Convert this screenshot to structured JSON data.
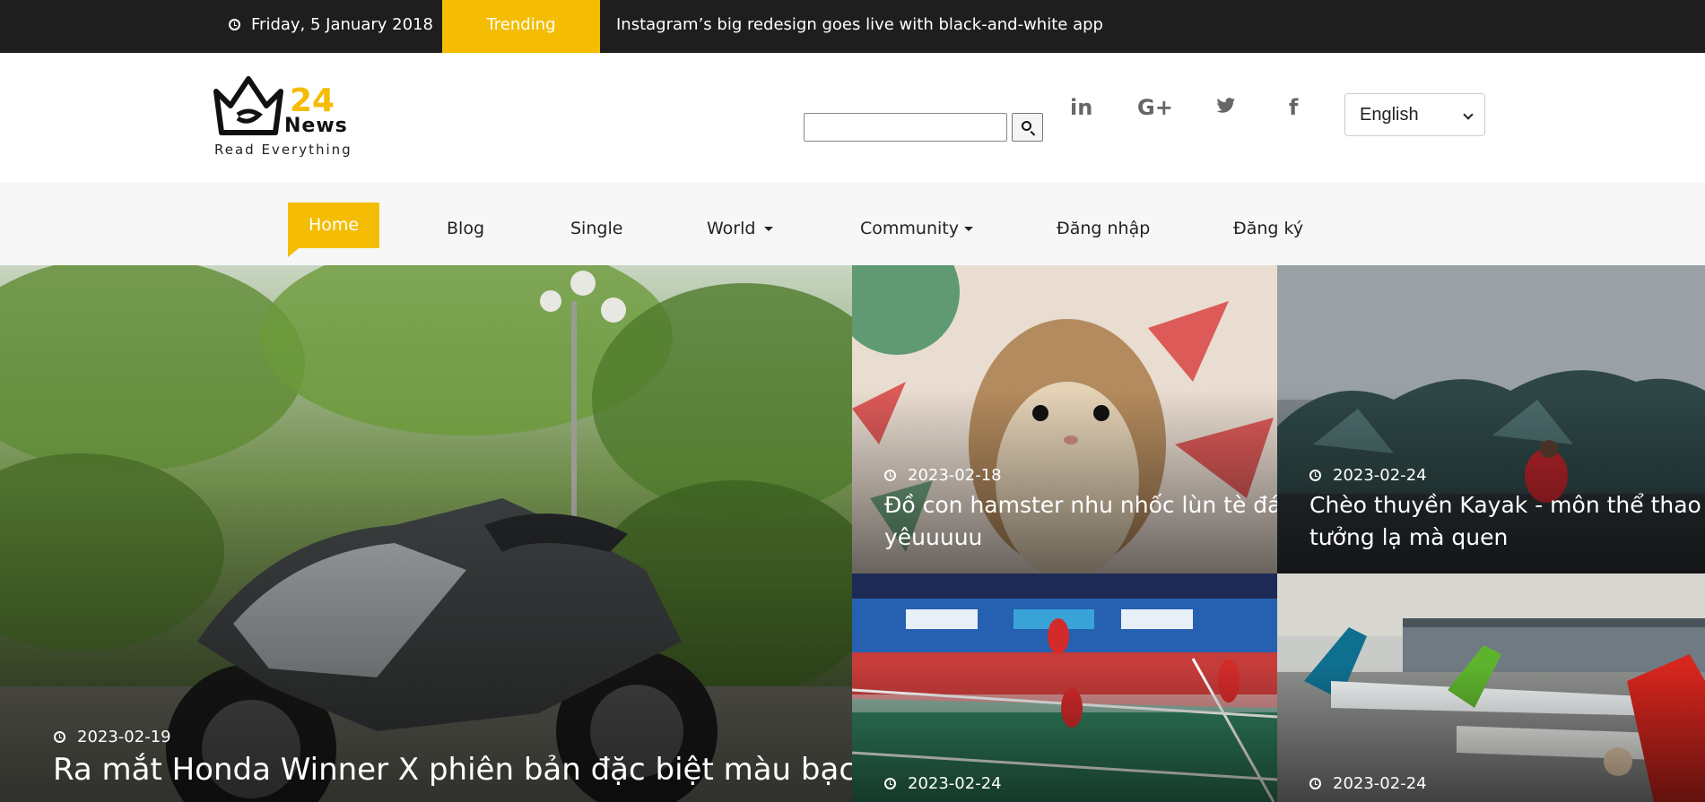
{
  "topbar": {
    "date": "Friday, 5 January 2018",
    "trending_label": "Trending",
    "headline": "Instagram’s big redesign goes live with black-and-white app"
  },
  "logo": {
    "number": "24",
    "word": "News",
    "tagline": "Read Everything"
  },
  "search": {
    "placeholder": "",
    "value": "",
    "button_icon": "search-icon"
  },
  "social": [
    {
      "name": "linkedin-icon",
      "glyph": "in"
    },
    {
      "name": "google-plus-icon",
      "glyph": "G+"
    },
    {
      "name": "twitter-icon",
      "glyph": "t"
    },
    {
      "name": "facebook-icon",
      "glyph": "f"
    }
  ],
  "language": {
    "selected": "English"
  },
  "nav": {
    "items": [
      {
        "label": "Home",
        "active": true
      },
      {
        "label": "Blog"
      },
      {
        "label": "Single"
      },
      {
        "label": "World",
        "dropdown": true
      },
      {
        "label": "Community",
        "dropdown": true
      },
      {
        "label": "Đăng nhập"
      },
      {
        "label": "Đăng ký"
      }
    ]
  },
  "featured": {
    "main": {
      "date": "2023-02-19",
      "title": "Ra mắt Honda Winner X phiên bản đặc biệt màu bạc"
    },
    "tiles": [
      {
        "date": "2023-02-18",
        "title_line1": "Đồ con hamster nhu nhốc lùn tè đáng",
        "title_line2": "yêuuuuu"
      },
      {
        "date": "2023-02-24",
        "title_line1": "Chèo thuyền Kayak - môn thể thao",
        "title_line2": "tưởng lạ mà quen"
      },
      {
        "date": "2023-02-24"
      },
      {
        "date": "2023-02-24"
      }
    ]
  },
  "colors": {
    "accent": "#f4bd03",
    "topbar": "#1e1e1e",
    "nav_bg": "#f7f7f7"
  }
}
